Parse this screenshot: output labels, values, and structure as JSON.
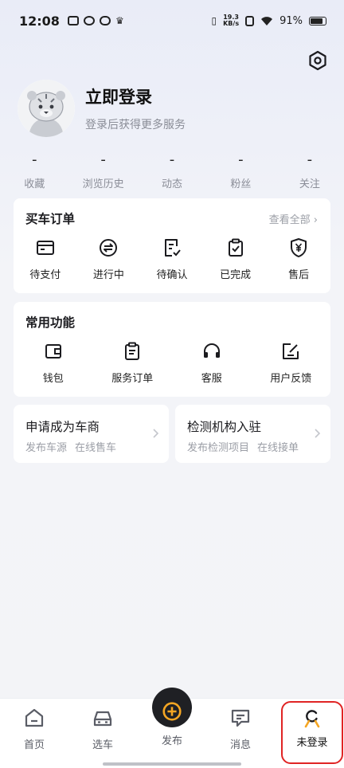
{
  "status_bar": {
    "time": "12:08",
    "net_speed_value": "19.3",
    "net_speed_unit": "KB/s",
    "battery": "91%"
  },
  "profile": {
    "title": "立即登录",
    "subtitle": "登录后获得更多服务"
  },
  "stats": [
    {
      "value": "-",
      "label": "收藏"
    },
    {
      "value": "-",
      "label": "浏览历史"
    },
    {
      "value": "-",
      "label": "动态"
    },
    {
      "value": "-",
      "label": "粉丝"
    },
    {
      "value": "-",
      "label": "关注"
    }
  ],
  "orders": {
    "title": "买车订单",
    "view_all": "查看全部",
    "items": [
      {
        "label": "待支付",
        "icon": "wallet-card-icon"
      },
      {
        "label": "进行中",
        "icon": "exchange-icon"
      },
      {
        "label": "待确认",
        "icon": "confirm-doc-icon"
      },
      {
        "label": "已完成",
        "icon": "clipboard-check-icon"
      },
      {
        "label": "售后",
        "icon": "shield-yen-icon"
      }
    ]
  },
  "functions": {
    "title": "常用功能",
    "items": [
      {
        "label": "钱包",
        "icon": "wallet-icon"
      },
      {
        "label": "服务订单",
        "icon": "order-list-icon"
      },
      {
        "label": "客服",
        "icon": "headset-icon"
      },
      {
        "label": "用户反馈",
        "icon": "edit-icon"
      }
    ]
  },
  "promos": [
    {
      "title": "申请成为车商",
      "subs": [
        "发布车源",
        "在线售车"
      ]
    },
    {
      "title": "检测机构入驻",
      "subs": [
        "发布检测项目",
        "在线接单"
      ]
    }
  ],
  "tabbar": {
    "items": [
      {
        "label": "首页",
        "icon": "home-icon"
      },
      {
        "label": "选车",
        "icon": "car-icon"
      },
      {
        "label": "发布",
        "icon": "publish-plus-icon"
      },
      {
        "label": "消息",
        "icon": "message-icon"
      },
      {
        "label": "未登录",
        "icon": "user-icon"
      }
    ]
  },
  "colors": {
    "accent": "#f5a623",
    "highlight_border": "#e02424"
  }
}
